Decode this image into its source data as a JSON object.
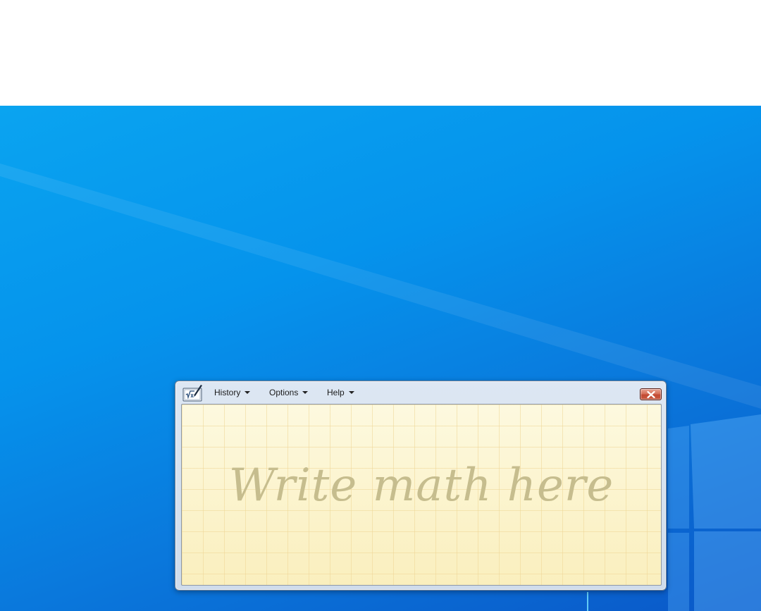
{
  "window": {
    "app_icon": "math-input-panel-icon",
    "menu": [
      {
        "label": "History"
      },
      {
        "label": "Options"
      },
      {
        "label": "Help"
      }
    ],
    "close_icon": "close-icon"
  },
  "writing_area": {
    "hint": "Write math here"
  },
  "colors": {
    "desktop_blue": "#0593ec",
    "pad_background": "#fbf3c7",
    "hint_text": "#c6bd8e",
    "close_button": "#c34a33"
  }
}
